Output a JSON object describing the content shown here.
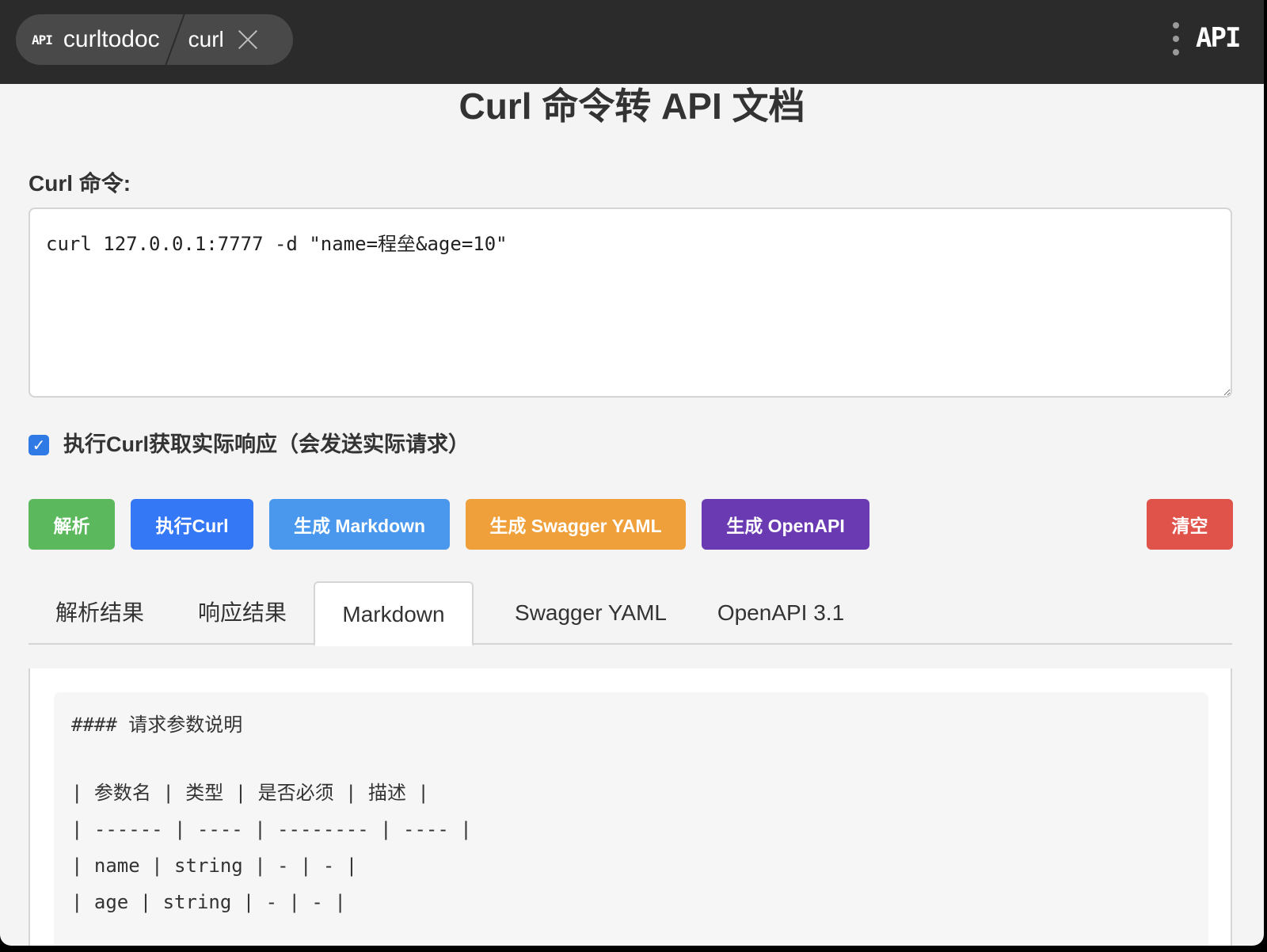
{
  "titlebar": {
    "logo_text": "API",
    "app_name": "curltodoc",
    "command_name": "curl",
    "brand": "API"
  },
  "page": {
    "title": "Curl 命令转 API 文档",
    "curl_label": "Curl 命令:",
    "curl_value": "curl 127.0.0.1:7777 -d \"name=程垒&age=10\"",
    "execute_checkbox_checked": true,
    "execute_checkbox_label": "执行Curl获取实际响应（会发送实际请求）"
  },
  "buttons": {
    "parse": "解析",
    "exec": "执行Curl",
    "markdown": "生成 Markdown",
    "swagger": "生成 Swagger YAML",
    "openapi": "生成 OpenAPI",
    "clear": "清空"
  },
  "tabs": {
    "active": "Markdown",
    "items": [
      "解析结果",
      "响应结果",
      "Markdown",
      "Swagger YAML",
      "OpenAPI 3.1"
    ]
  },
  "markdown_output": {
    "lines": [
      "#### 请求参数说明",
      "| 参数名 | 类型 | 是否必须 | 描述 |",
      "| ------ | ---- | -------- | ---- |",
      "| name | string | - | - |",
      "| age | string | - | - |"
    ]
  },
  "colors": {
    "parse": "#5cb85c",
    "exec": "#3478f6",
    "markdown": "#4a98ee",
    "swagger": "#f0a03a",
    "openapi": "#6a3ab3",
    "clear": "#e0534a",
    "titlebar": "#2b2b2b"
  }
}
